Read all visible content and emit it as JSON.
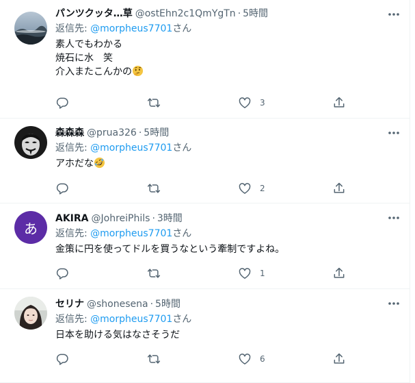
{
  "tweets": [
    {
      "name": "パンツクッタ…草",
      "handle": "@ostEhn2c1QmYgTn",
      "separator": "·",
      "time": "5時間",
      "replying_label": "返信先: ",
      "replying_mention": "@morpheus7701",
      "replying_suffix": "さん",
      "lines": [
        "素人でもわかる",
        "焼石に水　笑",
        "介入またこんかの"
      ],
      "emoji": "thinking-face",
      "like_count": "3"
    },
    {
      "name": "森森森",
      "handle": "@prua326",
      "separator": "·",
      "time": "5時間",
      "replying_label": "返信先: ",
      "replying_mention": "@morpheus7701",
      "replying_suffix": "さん",
      "lines": [
        "アホだな"
      ],
      "emoji": "rolling-on-floor-laughing",
      "like_count": "2"
    },
    {
      "name": "AKIRA",
      "handle": "@JohreiPhils",
      "separator": "·",
      "time": "3時間",
      "replying_label": "返信先: ",
      "replying_mention": "@morpheus7701",
      "replying_suffix": "さん",
      "avatar_letter": "あ",
      "lines": [
        "金策に円を使ってドルを買うなという牽制ですよね。"
      ],
      "like_count": "1"
    },
    {
      "name": "セリナ",
      "handle": "@shonesena",
      "separator": "·",
      "time": "5時間",
      "replying_label": "返信先: ",
      "replying_mention": "@morpheus7701",
      "replying_suffix": "さん",
      "lines": [
        "日本を助ける気はなさそうだ"
      ],
      "like_count": "6"
    }
  ],
  "icons": {
    "reply": "reply-icon",
    "retweet": "retweet-icon",
    "like": "like-icon",
    "share": "share-icon",
    "more": "more-icon"
  },
  "colors": {
    "text": "#0f1419",
    "secondary": "#536471",
    "link": "#1d9bf0",
    "divider": "#eff3f4",
    "avatar_purple": "#5c2ca6"
  }
}
